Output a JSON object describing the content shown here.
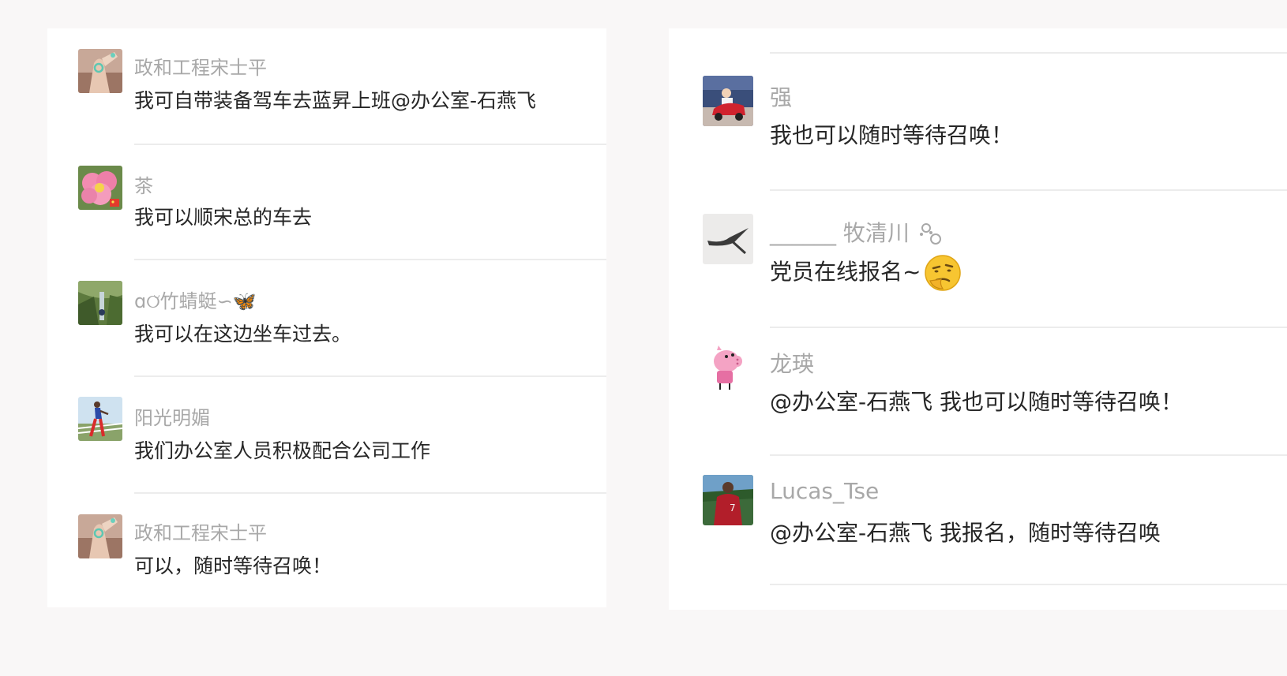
{
  "left_comments": [
    {
      "author": "政和工程宋士平",
      "text": "我可自带装备驾车去蓝昇上班@办公室-石燕飞",
      "avatar_icon": "hand-ring-avatar-icon"
    },
    {
      "author": "茶",
      "text": "我可以顺宋总的车去",
      "avatar_icon": "pink-flower-avatar-icon"
    },
    {
      "author": "ɑ୦̆竹蜻蜓∽🦋",
      "text": "我可以在这边坐车过去。",
      "avatar_icon": "waterfall-avatar-icon"
    },
    {
      "author": "阳光明媚",
      "text": "我们办公室人员积极配合公司工作",
      "avatar_icon": "runner-avatar-icon"
    },
    {
      "author": "政和工程宋士平",
      "text": "可以，随时等待召唤！",
      "avatar_icon": "hand-ring-avatar-icon"
    }
  ],
  "right_comments": [
    {
      "author": "强",
      "text": "我也可以随时等待召唤！",
      "avatar_icon": "child-car-avatar-icon"
    },
    {
      "author": "______ 牧清川",
      "text": "党员在线报名~",
      "avatar_icon": "swallow-avatar-icon"
    },
    {
      "author": "龙瑛",
      "text": "@办公室-石燕飞 我也可以随时等待召唤！",
      "avatar_icon": "pink-pig-avatar-icon"
    },
    {
      "author": "Lucas_Tse",
      "text": "@办公室-石燕飞 我报名，随时等待召唤",
      "avatar_icon": "football-player-avatar-icon"
    }
  ],
  "colors": {
    "background": "#f9f7f7",
    "panel": "#ffffff",
    "author": "#a8a8a8",
    "text": "#262626",
    "divider": "#ececec"
  }
}
